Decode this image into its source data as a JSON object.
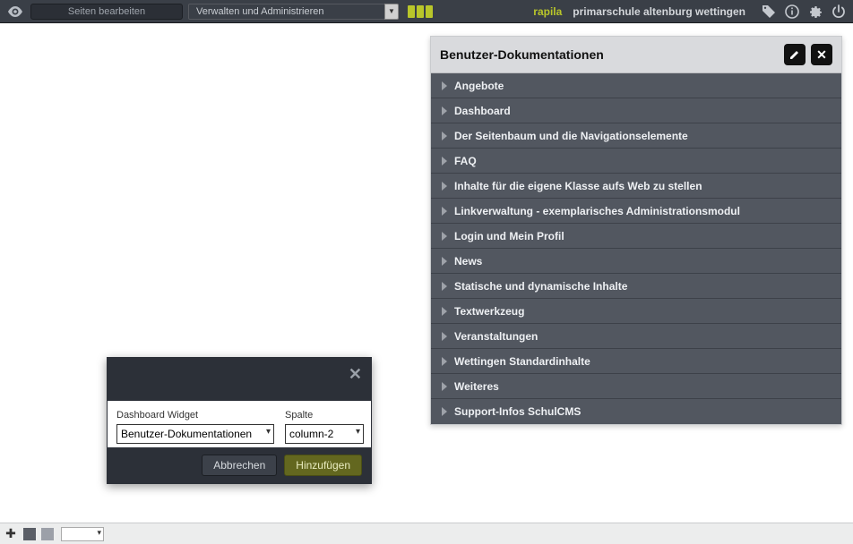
{
  "topbar": {
    "edit_pages_label": "Seiten bearbeiten",
    "admin_dropdown_label": "Verwalten und Administrieren",
    "brand": "rapila",
    "site_name": "primarschule altenburg wettingen"
  },
  "panel": {
    "title": "Benutzer-Dokumentationen",
    "items": [
      "Angebote",
      "Dashboard",
      "Der Seitenbaum und die Navigationselemente",
      "FAQ",
      "Inhalte für die eigene Klasse aufs Web zu stellen",
      "Linkverwaltung - exemplarisches Administrationsmodul",
      "Login und Mein Profil",
      "News",
      "Statische und dynamische Inhalte",
      "Textwerkzeug",
      "Veranstaltungen",
      "Wettingen Standardinhalte",
      "Weiteres",
      "Support-Infos SchulCMS"
    ]
  },
  "dialog": {
    "widget_label": "Dashboard Widget",
    "widget_value": "Benutzer-Dokumentationen",
    "column_label": "Spalte",
    "column_value": "column-2",
    "cancel_label": "Abbrechen",
    "add_label": "Hinzufügen"
  }
}
